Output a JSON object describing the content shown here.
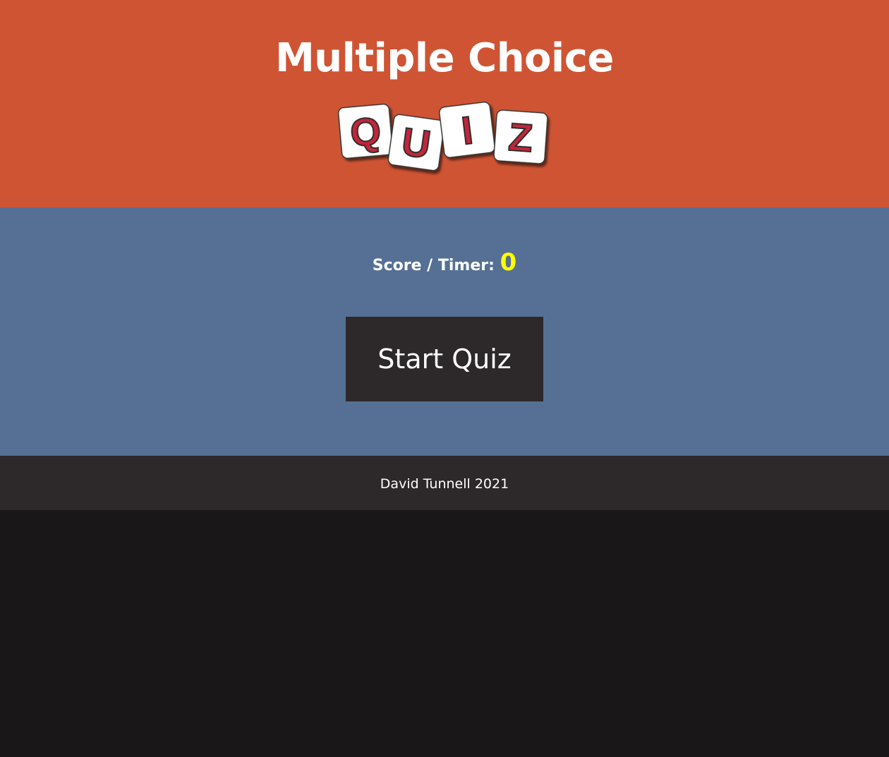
{
  "header": {
    "title": "Multiple Choice",
    "logo": {
      "icon": "quiz-tiles-logo",
      "letters": [
        "Q",
        "U",
        "I",
        "Z"
      ],
      "tile_color": "#ffffff",
      "letter_color": "#c0283a"
    }
  },
  "main": {
    "score_label": "Score / Timer:",
    "score_value": "0",
    "start_button_label": "Start Quiz"
  },
  "footer": {
    "text": "David Tunnell 2021"
  },
  "colors": {
    "header_bg": "#cf5434",
    "main_bg": "#557094",
    "footer_bg": "#2d282a",
    "page_bg": "#191718",
    "score_accent": "#ffff00"
  }
}
